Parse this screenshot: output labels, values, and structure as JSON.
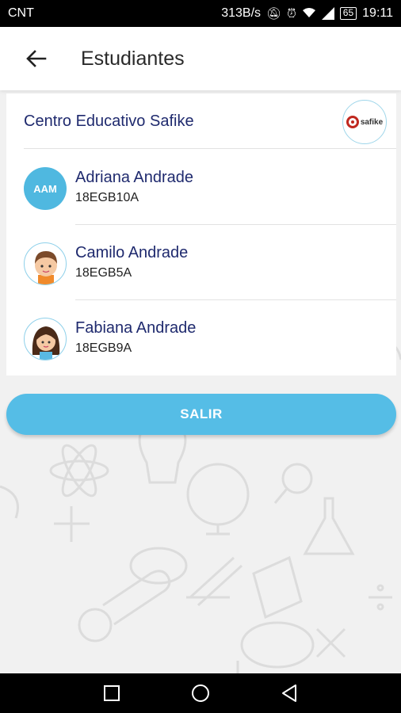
{
  "status_bar": {
    "carrier": "CNT",
    "net_speed": "313B/s",
    "battery": "65",
    "time": "19:11"
  },
  "app_bar": {
    "title": "Estudiantes",
    "back_icon": "arrow-left-icon"
  },
  "school": {
    "name": "Centro Educativo Safike",
    "logo_text": "safike"
  },
  "students": [
    {
      "name": "Adriana Andrade",
      "code": "18EGB10A",
      "avatar": "initials",
      "initials": "AAM"
    },
    {
      "name": "Camilo Andrade",
      "code": "18EGB5A",
      "avatar": "boy-avatar"
    },
    {
      "name": "Fabiana Andrade",
      "code": "18EGB9A",
      "avatar": "girl-avatar"
    }
  ],
  "exit_button": {
    "label": "SALIR"
  },
  "colors": {
    "accent": "#55bde6",
    "text_primary": "#1f2a6e",
    "initials_bg": "#4fb8e0"
  },
  "nav": {
    "icons": [
      "square-recent-icon",
      "circle-home-icon",
      "triangle-back-icon"
    ]
  }
}
